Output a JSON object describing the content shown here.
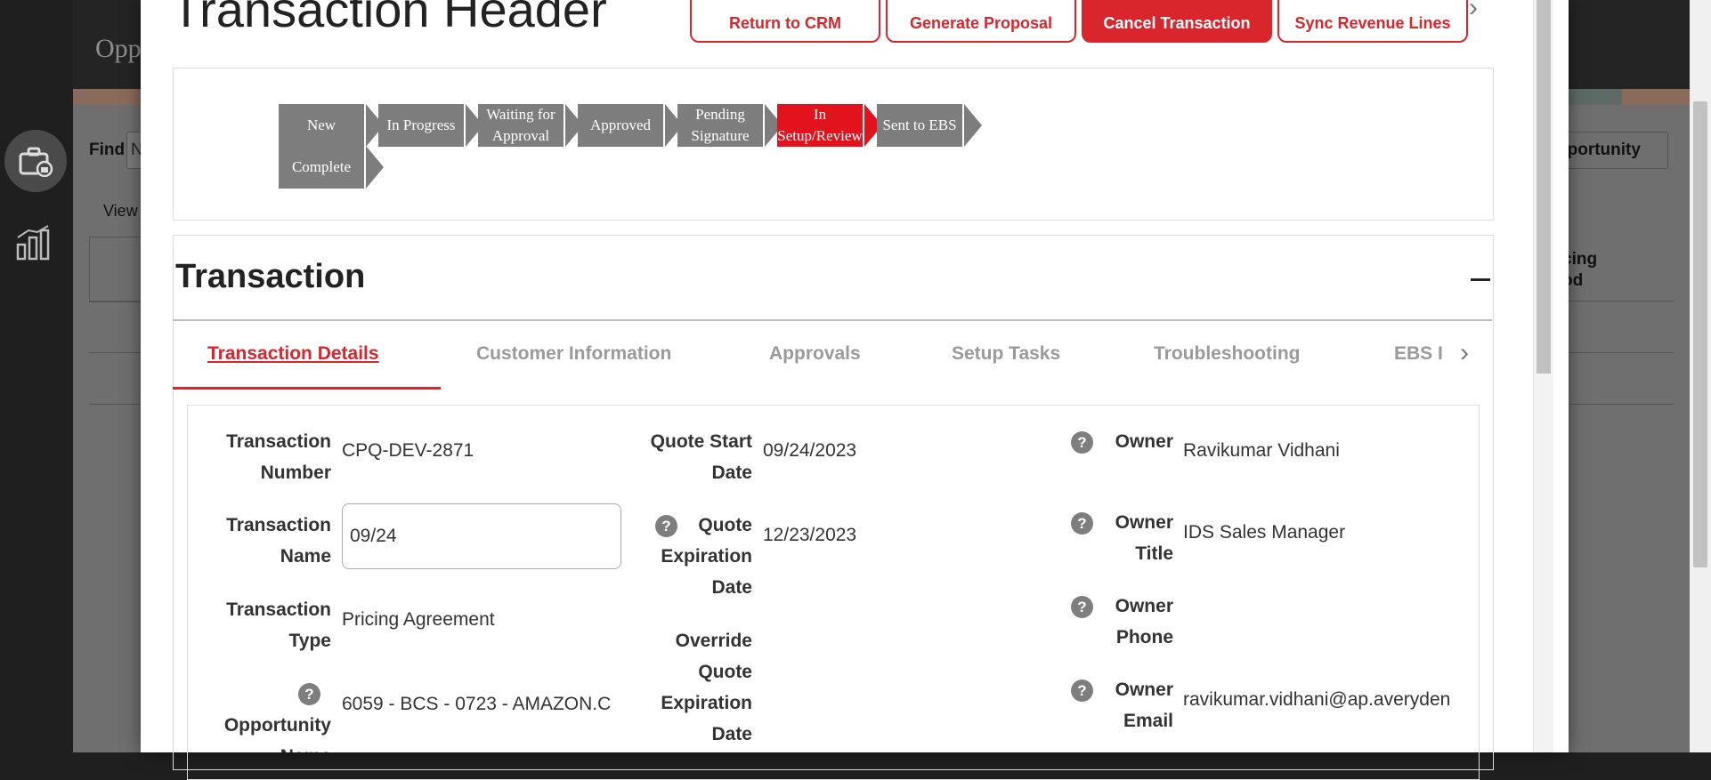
{
  "background": {
    "app_title": "Opp",
    "find_label": "Find",
    "find_value": "N",
    "view_label": "View",
    "opportunity_button": "pportunity",
    "column_header_line1": "cing",
    "column_header_line2": "od"
  },
  "modal": {
    "title": "Transaction Header",
    "actions": [
      {
        "label": "Return to CRM"
      },
      {
        "label": "Generate Proposal"
      },
      {
        "label": "Cancel Transaction"
      },
      {
        "label": "Sync Revenue Lines"
      }
    ],
    "stages": [
      {
        "label": "New",
        "active": false
      },
      {
        "label": "In Progress",
        "active": false
      },
      {
        "label": "Waiting for Approval",
        "active": false
      },
      {
        "label": "Approved",
        "active": false
      },
      {
        "label": "Pending Signature",
        "active": false
      },
      {
        "label": "In Setup/Review",
        "active": true
      },
      {
        "label": "Sent to EBS",
        "active": false
      },
      {
        "label": "Complete",
        "active": false
      }
    ],
    "section_title": "Transaction",
    "tabs": [
      {
        "label": "Transaction Details",
        "active": true
      },
      {
        "label": "Customer Information",
        "active": false
      },
      {
        "label": "Approvals",
        "active": false
      },
      {
        "label": "Setup Tasks",
        "active": false
      },
      {
        "label": "Troubleshooting",
        "active": false
      },
      {
        "label": "EBS I",
        "active": false
      }
    ],
    "fields": {
      "transaction_number": {
        "label": "Transaction Number",
        "value": "CPQ-DEV-2871"
      },
      "transaction_name": {
        "label": "Transaction Name",
        "value": "09/24"
      },
      "transaction_type": {
        "label": "Transaction Type",
        "value": "Pricing Agreement"
      },
      "opportunity_name": {
        "label": "Opportunity Name",
        "value": "6059 - BCS - 0723 - AMAZON.C"
      },
      "quote_start_date": {
        "label": "Quote Start Date",
        "value": "09/24/2023"
      },
      "quote_expiration_date": {
        "label": "Quote Expiration Date",
        "value": "12/23/2023"
      },
      "override_quote_expiration_date": {
        "label": "Override Quote Expiration Date",
        "value": ""
      },
      "owner": {
        "label": "Owner",
        "value": "Ravikumar Vidhani"
      },
      "owner_title": {
        "label": "Owner Title",
        "value": "IDS Sales Manager"
      },
      "owner_phone": {
        "label": "Owner Phone",
        "value": ""
      },
      "owner_email": {
        "label": "Owner Email",
        "value": "ravikumar.vidhani@ap.averyden"
      }
    }
  },
  "colors": {
    "accent": "#d9262c",
    "stage_active": "#e3131e",
    "stage_default": "#7d7d7d"
  },
  "icons": {
    "help": "question-circle-icon",
    "next": "chevron-right-icon",
    "collapse": "minus-icon"
  }
}
